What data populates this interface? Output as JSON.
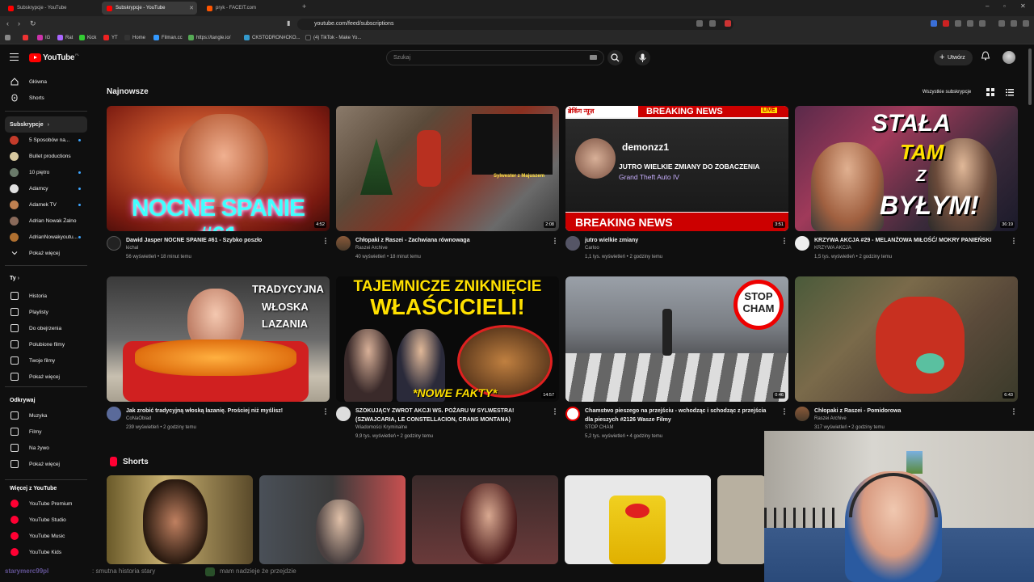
{
  "browser": {
    "tabs": [
      {
        "label": "Subskrypcje - YouTube"
      },
      {
        "label": "Subskrypcje - YouTube"
      },
      {
        "label": "pryk - FACEIT.com"
      }
    ],
    "url": "youtube.com/feed/subscriptions",
    "bookmarks": [
      "IG",
      "Rat",
      "Kick",
      "YT",
      "Home",
      "Filman.cc",
      "https://tangle.io/",
      "CKSTODRON#CKO...",
      "(4) TikTok - Make Yo..."
    ]
  },
  "header": {
    "logo_text": "YouTube",
    "logo_region": "PL",
    "search_placeholder": "Szukaj",
    "create_label": "Utwórz"
  },
  "sidebar": {
    "main": [
      {
        "label": "Główna",
        "icon": "home-icon"
      },
      {
        "label": "Shorts",
        "icon": "shorts-icon"
      }
    ],
    "subs_header": "Subskrypcje",
    "subscriptions": [
      {
        "label": "5 Sposobów na...",
        "color": "#c43b2a",
        "dot": true
      },
      {
        "label": "Bullet productions",
        "color": "#d8c9a0",
        "dot": false
      },
      {
        "label": "10 piętro",
        "color": "#6a7a6a",
        "dot": true
      },
      {
        "label": "Adamcy",
        "color": "#e0e0e0",
        "dot": true
      },
      {
        "label": "Adamek TV",
        "color": "#c08050",
        "dot": true
      },
      {
        "label": "Adrian Nowak Żalno",
        "color": "#8a6a5a",
        "dot": false
      },
      {
        "label": "AdrianNowakyoutu...",
        "color": "#b07030",
        "dot": true
      }
    ],
    "subs_more": "Pokaż więcej",
    "you_header": "Ty",
    "you_items": [
      {
        "label": "Historia",
        "icon": "history-icon"
      },
      {
        "label": "Playlisty",
        "icon": "playlist-icon"
      },
      {
        "label": "Do obejrzenia",
        "icon": "watch-later-icon"
      },
      {
        "label": "Polubione filmy",
        "icon": "like-icon"
      },
      {
        "label": "Twoje filmy",
        "icon": "your-videos-icon"
      },
      {
        "label": "Pokaż więcej",
        "icon": "chevron-down-icon"
      }
    ],
    "explore_header": "Odkrywaj",
    "explore_items": [
      {
        "label": "Muzyka",
        "icon": "music-icon"
      },
      {
        "label": "Filmy",
        "icon": "film-icon"
      },
      {
        "label": "Na żywo",
        "icon": "live-icon"
      },
      {
        "label": "Pokaż więcej",
        "icon": "chevron-down-icon"
      }
    ],
    "more_header": "Więcej z YouTube",
    "more_items": [
      {
        "label": "YouTube Premium"
      },
      {
        "label": "YouTube Studio"
      },
      {
        "label": "YouTube Music"
      },
      {
        "label": "YouTube Kids"
      }
    ]
  },
  "feed": {
    "section_title": "Najnowsze",
    "all_subs_label": "Wszystkie subskrypcje",
    "videos": [
      {
        "title": "Dawid Jasper NOCNE SPANIE #61 - Szybko poszło",
        "channel": "kichal",
        "stats": "56 wyświetleń • 18 minut temu",
        "duration": "4:52",
        "overlay": "NOCNE SPANIE #61"
      },
      {
        "title": "Chłopaki z Raszei - Zachwiana równowaga",
        "channel": "Raszei Archive",
        "stats": "40 wyświetleń • 18 minut temu",
        "duration": "2:08",
        "overlay": "Sylwester z Majuszem"
      },
      {
        "title": "jutro wielkie zmiany",
        "channel": "Carloo",
        "stats": "1,1 tys. wyświetleń • 2 godziny temu",
        "duration": "3:51",
        "overlay_top": "BREAKING NEWS",
        "overlay_live": "LIVE",
        "overlay_hindi": "ब्रेकिंग न्यूज़",
        "overlay_user": "demonzz1",
        "overlay_line1": "JUTRO WIELKIE ZMIANY DO ZOBACZENIA",
        "overlay_line2": "Grand Theft Auto IV",
        "overlay_bottom": "BREAKING NEWS"
      },
      {
        "title": "KRZYWA AKCJA #29 - MELANŻOWA MIŁOŚĆ/ MOKRY PANIEŃSKI",
        "channel": "KRZYWA AKCJA",
        "stats": "1,5 tys. wyświetleń • 2 godziny temu",
        "duration": "36:19",
        "overlay_a": "STAŁA",
        "overlay_b": "TAM",
        "overlay_c": "Z",
        "overlay_d": "BYŁYM!"
      },
      {
        "title": "Jak zrobić tradycyjną włoską lazanię. Prościej niż myślisz!",
        "channel": "CoNaObiad",
        "stats": "239 wyświetleń • 2 godziny temu",
        "duration": "",
        "overlay_a": "TRADYCYJNA",
        "overlay_b": "WŁOSKA",
        "overlay_c": "LAZANIA"
      },
      {
        "title": "SZOKUJĄCY ZWROT AKCJI WS. POŻARU W SYLWESTRA! (SZWAJCARIA, LE CONSTELLACION, CRANS MONTANA)",
        "channel": "Wiadomości Kryminalne",
        "stats": "9,9 tys. wyświetleń • 2 godziny temu",
        "duration": "14:57",
        "overlay_a": "TAJEMNICZE ZNIKNIĘCIE",
        "overlay_b": "WŁAŚCICIELI!",
        "overlay_c": "*NOWE FAKTY*"
      },
      {
        "title": "Chamstwo pieszego na przejściu - wchodząc i schodząc z przejścia dla pieszych #2126 Wasze Filmy",
        "channel": "STOP CHAM",
        "stats": "5,2 tys. wyświetleń • 4 godziny temu",
        "duration": "0:46",
        "overlay_a": "STOP",
        "overlay_b": "CHAM"
      },
      {
        "title": "Chłopaki z Raszei - Pomidorowa",
        "channel": "Raszei Archive",
        "stats": "317 wyświetleń • 2 godziny temu",
        "duration": "6:43"
      }
    ],
    "shorts_title": "Shorts"
  },
  "chat": {
    "user": "starymerc99pl",
    "message": ": smutna historia stary",
    "message2": "mam nadzieje że przejdzie"
  }
}
